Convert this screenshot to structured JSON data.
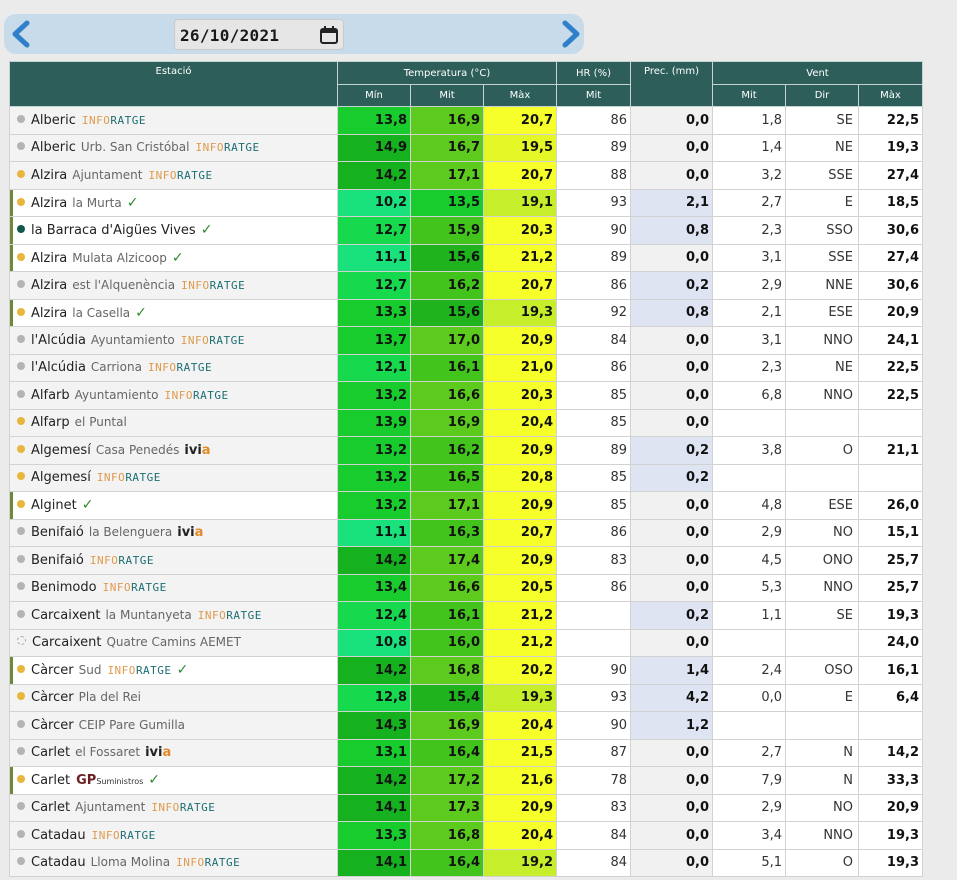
{
  "nav": {
    "date": "26/10/2021",
    "prev_icon": "chevron-left-icon",
    "next_icon": "chevron-right-icon",
    "calendar_icon": "calendar-icon"
  },
  "headers": {
    "station": "Estació",
    "temperature": "Temperatura (°C)",
    "hr": "HR (%)",
    "prec": "Prec. (mm)",
    "wind": "Vent",
    "t_min": "Mín",
    "t_mit": "Mit",
    "t_max": "Màx",
    "hr_mit": "Mit",
    "w_mit": "Mit",
    "w_dir": "Dir",
    "w_max": "Màx"
  },
  "colors": {
    "header_bg": "#2e5e5a",
    "dot_gold": "#e8b63c",
    "dot_gray": "#b4b4b4",
    "dot_teal": "#11594f",
    "max_yellow": "#f7ff2a",
    "wet_blue": "#dfe4f2",
    "check_green": "#2e8b2e"
  },
  "logo_text": {
    "inforatge_a": "INFO",
    "inforatge_b": "RATGE",
    "ivia_a": "ivi",
    "ivia_b": "a",
    "gp": "GP",
    "gp_sub": "Suministros",
    "check": "✓"
  },
  "rows": [
    {
      "name": "Alberic",
      "sub": "",
      "logo": "inforatge",
      "check": false,
      "dot": "gray",
      "hl": false,
      "tmin": "13,8",
      "tmit": "16,9",
      "tmax": "20,7",
      "hr": "86",
      "prec": "0,0",
      "wet": false,
      "wmit": "1,8",
      "wdir": "SE",
      "wmax": "22,5"
    },
    {
      "name": "Alberic",
      "sub": "Urb. San Cristóbal",
      "logo": "inforatge",
      "check": false,
      "dot": "gray",
      "hl": false,
      "tmin": "14,9",
      "tmit": "16,7",
      "tmax": "19,5",
      "hr": "89",
      "prec": "0,0",
      "wet": false,
      "wmit": "1,4",
      "wdir": "NE",
      "wmax": "19,3"
    },
    {
      "name": "Alzira",
      "sub": "Ajuntament",
      "logo": "inforatge",
      "check": false,
      "dot": "gold",
      "hl": false,
      "tmin": "14,2",
      "tmit": "17,1",
      "tmax": "20,7",
      "hr": "88",
      "prec": "0,0",
      "wet": false,
      "wmit": "3,2",
      "wdir": "SSE",
      "wmax": "27,4"
    },
    {
      "name": "Alzira",
      "sub": "la Murta",
      "logo": "",
      "check": true,
      "dot": "gold",
      "hl": true,
      "tmin": "10,2",
      "tmit": "13,5",
      "tmax": "19,1",
      "hr": "93",
      "prec": "2,1",
      "wet": true,
      "wmit": "2,7",
      "wdir": "E",
      "wmax": "18,5"
    },
    {
      "name": "la Barraca d'Aigües Vives",
      "sub": "",
      "logo": "",
      "check": true,
      "dot": "teal",
      "hl": true,
      "tmin": "12,7",
      "tmit": "15,9",
      "tmax": "20,3",
      "hr": "90",
      "prec": "0,8",
      "wet": true,
      "wmit": "2,3",
      "wdir": "SSO",
      "wmax": "30,6"
    },
    {
      "name": "Alzira",
      "sub": "Mulata Alzicoop",
      "logo": "",
      "check": true,
      "dot": "gold",
      "hl": true,
      "tmin": "11,1",
      "tmit": "15,6",
      "tmax": "21,2",
      "hr": "89",
      "prec": "0,0",
      "wet": false,
      "wmit": "3,1",
      "wdir": "SSE",
      "wmax": "27,4"
    },
    {
      "name": "Alzira",
      "sub": "est l'Alquenència",
      "logo": "inforatge",
      "check": false,
      "dot": "gray",
      "hl": false,
      "tmin": "12,7",
      "tmit": "16,2",
      "tmax": "20,7",
      "hr": "86",
      "prec": "0,2",
      "wet": true,
      "wmit": "2,9",
      "wdir": "NNE",
      "wmax": "30,6"
    },
    {
      "name": "Alzira",
      "sub": "la Casella",
      "logo": "",
      "check": true,
      "dot": "gold",
      "hl": true,
      "tmin": "13,3",
      "tmit": "15,6",
      "tmax": "19,3",
      "hr": "92",
      "prec": "0,8",
      "wet": true,
      "wmit": "2,1",
      "wdir": "ESE",
      "wmax": "20,9"
    },
    {
      "name": "l'Alcúdia",
      "sub": "Ayuntamiento",
      "logo": "inforatge",
      "check": false,
      "dot": "gray",
      "hl": false,
      "tmin": "13,7",
      "tmit": "17,0",
      "tmax": "20,9",
      "hr": "84",
      "prec": "0,0",
      "wet": false,
      "wmit": "3,1",
      "wdir": "NNO",
      "wmax": "24,1"
    },
    {
      "name": "l'Alcúdia",
      "sub": "Carriona",
      "logo": "inforatge",
      "check": false,
      "dot": "gray",
      "hl": false,
      "tmin": "12,1",
      "tmit": "16,1",
      "tmax": "21,0",
      "hr": "86",
      "prec": "0,0",
      "wet": false,
      "wmit": "2,3",
      "wdir": "NE",
      "wmax": "22,5"
    },
    {
      "name": "Alfarb",
      "sub": "Ayuntamiento",
      "logo": "inforatge",
      "check": false,
      "dot": "gray",
      "hl": false,
      "tmin": "13,2",
      "tmit": "16,6",
      "tmax": "20,3",
      "hr": "85",
      "prec": "0,0",
      "wet": false,
      "wmit": "6,8",
      "wdir": "NNO",
      "wmax": "22,5"
    },
    {
      "name": "Alfarp",
      "sub": "el Puntal",
      "logo": "",
      "check": false,
      "dot": "gold",
      "hl": false,
      "tmin": "13,9",
      "tmit": "16,9",
      "tmax": "20,4",
      "hr": "85",
      "prec": "0,0",
      "wet": false,
      "wmit": "",
      "wdir": "",
      "wmax": ""
    },
    {
      "name": "Algemesí",
      "sub": "Casa Penedés",
      "logo": "ivia",
      "check": false,
      "dot": "gold",
      "hl": false,
      "tmin": "13,2",
      "tmit": "16,2",
      "tmax": "20,9",
      "hr": "89",
      "prec": "0,2",
      "wet": true,
      "wmit": "3,8",
      "wdir": "O",
      "wmax": "21,1"
    },
    {
      "name": "Algemesí",
      "sub": "",
      "logo": "inforatge",
      "check": false,
      "dot": "gold",
      "hl": false,
      "tmin": "13,2",
      "tmit": "16,5",
      "tmax": "20,8",
      "hr": "85",
      "prec": "0,2",
      "wet": true,
      "wmit": "",
      "wdir": "",
      "wmax": ""
    },
    {
      "name": "Alginet",
      "sub": "",
      "logo": "",
      "check": true,
      "dot": "gold",
      "hl": true,
      "tmin": "13,2",
      "tmit": "17,1",
      "tmax": "20,9",
      "hr": "85",
      "prec": "0,0",
      "wet": false,
      "wmit": "4,8",
      "wdir": "ESE",
      "wmax": "26,0"
    },
    {
      "name": "Benifaió",
      "sub": "la Belenguera",
      "logo": "ivia",
      "check": false,
      "dot": "gray",
      "hl": false,
      "tmin": "11,1",
      "tmit": "16,3",
      "tmax": "20,7",
      "hr": "86",
      "prec": "0,0",
      "wet": false,
      "wmit": "2,9",
      "wdir": "NO",
      "wmax": "15,1"
    },
    {
      "name": "Benifaió",
      "sub": "",
      "logo": "inforatge",
      "check": false,
      "dot": "gray",
      "hl": false,
      "tmin": "14,2",
      "tmit": "17,4",
      "tmax": "20,9",
      "hr": "83",
      "prec": "0,0",
      "wet": false,
      "wmit": "4,5",
      "wdir": "ONO",
      "wmax": "25,7"
    },
    {
      "name": "Benimodo",
      "sub": "",
      "logo": "inforatge",
      "check": false,
      "dot": "gray",
      "hl": false,
      "tmin": "13,4",
      "tmit": "16,6",
      "tmax": "20,5",
      "hr": "86",
      "prec": "0,0",
      "wet": false,
      "wmit": "5,3",
      "wdir": "NNO",
      "wmax": "25,7"
    },
    {
      "name": "Carcaixent",
      "sub": "la Muntanyeta",
      "logo": "inforatge",
      "check": false,
      "dot": "gray",
      "hl": false,
      "tmin": "12,4",
      "tmit": "16,1",
      "tmax": "21,2",
      "hr": "",
      "prec": "0,2",
      "wet": true,
      "wmit": "1,1",
      "wdir": "SE",
      "wmax": "19,3"
    },
    {
      "name": "Carcaixent",
      "sub": "Quatre Camins AEMET",
      "logo": "",
      "check": false,
      "dot": "dashed",
      "hl": false,
      "tmin": "10,8",
      "tmit": "16,0",
      "tmax": "21,2",
      "hr": "",
      "prec": "0,0",
      "wet": false,
      "wmit": "",
      "wdir": "",
      "wmax": "24,0"
    },
    {
      "name": "Càrcer",
      "sub": "Sud",
      "logo": "inforatge",
      "check": true,
      "dot": "gold",
      "hl": true,
      "tmin": "14,2",
      "tmit": "16,8",
      "tmax": "20,2",
      "hr": "90",
      "prec": "1,4",
      "wet": true,
      "wmit": "2,4",
      "wdir": "OSO",
      "wmax": "16,1"
    },
    {
      "name": "Càrcer",
      "sub": "Pla del Rei",
      "logo": "",
      "check": false,
      "dot": "gold",
      "hl": false,
      "tmin": "12,8",
      "tmit": "15,4",
      "tmax": "19,3",
      "hr": "93",
      "prec": "4,2",
      "wet": true,
      "wmit": "0,0",
      "wdir": "E",
      "wmax": "6,4"
    },
    {
      "name": "Càrcer",
      "sub": "CEIP Pare Gumilla",
      "logo": "",
      "check": false,
      "dot": "gray",
      "hl": false,
      "tmin": "14,3",
      "tmit": "16,9",
      "tmax": "20,4",
      "hr": "90",
      "prec": "1,2",
      "wet": true,
      "wmit": "",
      "wdir": "",
      "wmax": ""
    },
    {
      "name": "Carlet",
      "sub": "el Fossaret",
      "logo": "ivia",
      "check": false,
      "dot": "gray",
      "hl": false,
      "tmin": "13,1",
      "tmit": "16,4",
      "tmax": "21,5",
      "hr": "87",
      "prec": "0,0",
      "wet": false,
      "wmit": "2,7",
      "wdir": "N",
      "wmax": "14,2"
    },
    {
      "name": "Carlet",
      "sub": "",
      "logo": "gp",
      "check": true,
      "dot": "gold",
      "hl": true,
      "tmin": "14,2",
      "tmit": "17,2",
      "tmax": "21,6",
      "hr": "78",
      "prec": "0,0",
      "wet": false,
      "wmit": "7,9",
      "wdir": "N",
      "wmax": "33,3"
    },
    {
      "name": "Carlet",
      "sub": "Ajuntament",
      "logo": "inforatge",
      "check": false,
      "dot": "gray",
      "hl": false,
      "tmin": "14,1",
      "tmit": "17,3",
      "tmax": "20,9",
      "hr": "83",
      "prec": "0,0",
      "wet": false,
      "wmit": "2,9",
      "wdir": "NO",
      "wmax": "20,9"
    },
    {
      "name": "Catadau",
      "sub": "",
      "logo": "inforatge",
      "check": false,
      "dot": "gray",
      "hl": false,
      "tmin": "13,3",
      "tmit": "16,8",
      "tmax": "20,4",
      "hr": "84",
      "prec": "0,0",
      "wet": false,
      "wmit": "3,4",
      "wdir": "NNO",
      "wmax": "19,3"
    },
    {
      "name": "Catadau",
      "sub": "Lloma Molina",
      "logo": "inforatge",
      "check": false,
      "dot": "gray",
      "hl": false,
      "tmin": "14,1",
      "tmit": "16,4",
      "tmax": "19,2",
      "hr": "84",
      "prec": "0,0",
      "wet": false,
      "wmit": "5,1",
      "wdir": "O",
      "wmax": "19,3"
    }
  ]
}
